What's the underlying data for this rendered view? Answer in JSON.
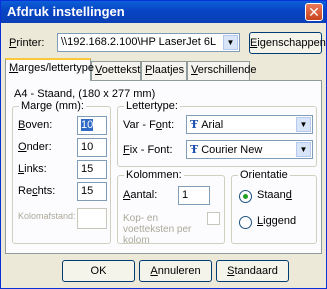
{
  "window": {
    "title": "Afdruk instellingen",
    "close_glyph": "✕"
  },
  "printer": {
    "label_prefix": "P",
    "label_rest": "rinter:",
    "value": "\\\\192.168.2.100\\HP LaserJet 6L",
    "properties_button": {
      "u": "E",
      "rest": "igenschappen"
    }
  },
  "tabs": [
    {
      "u": "M",
      "rest": "arges/lettertype"
    },
    {
      "u": "V",
      "rest": "oettekst"
    },
    {
      "u": "P",
      "rest": "laatjes"
    },
    {
      "u": "V",
      "rest": "erschillende"
    }
  ],
  "paper_info": "A4 - Staand,  (180 x 277 mm)",
  "margins": {
    "title": "Marge (mm):",
    "top": {
      "u": "B",
      "rest": "oven:",
      "value": "10"
    },
    "bottom": {
      "u": "O",
      "rest": "nder:",
      "value": "10"
    },
    "left": {
      "u": "L",
      "rest": "inks:",
      "value": "15"
    },
    "right": {
      "pre": "Re",
      "u": "c",
      "rest": "hts:",
      "value": "15"
    },
    "column_spacing": {
      "label": "Kolomafstand:",
      "value": ""
    }
  },
  "fonts": {
    "title": "Lettertype:",
    "var": {
      "pre": "Var - F",
      "u": "o",
      "rest": "nt:",
      "value": "Arial"
    },
    "fix": {
      "pre": "",
      "u": "F",
      "rest": "ix - Font:",
      "value": "Courier New"
    }
  },
  "columns": {
    "title": "Kolommen:",
    "count": {
      "u": "A",
      "rest": "antal:",
      "value": "1"
    },
    "headers_footers_per_column": "Kop- en voetteksten per kolom"
  },
  "orientation": {
    "title": "Orientatie",
    "portrait": {
      "pre": "Staan",
      "u": "d",
      "rest": "",
      "selected": true
    },
    "landscape": {
      "pre": "",
      "u": "L",
      "rest": "iggend",
      "selected": false
    }
  },
  "footer_buttons": {
    "ok": "OK",
    "cancel": {
      "u": "A",
      "rest": "nnuleren"
    },
    "default": {
      "u": "S",
      "rest": "tandaard"
    }
  },
  "icons": {
    "dropdown": "▼",
    "font": "Ŧ"
  }
}
